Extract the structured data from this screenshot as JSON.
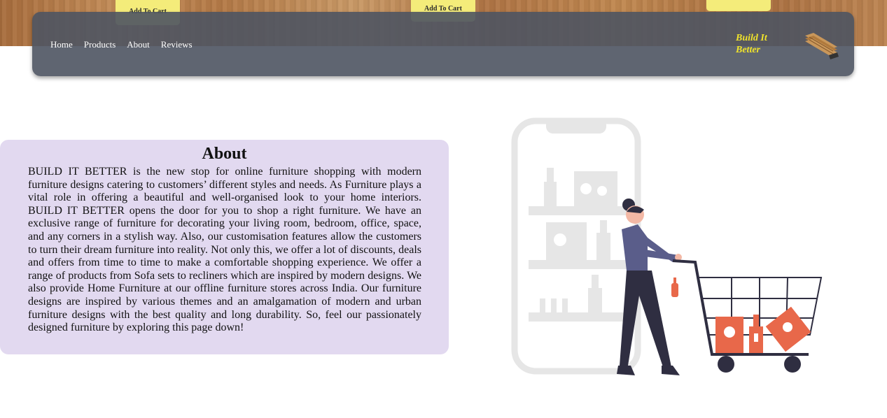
{
  "top_buttons": [
    {
      "label": "Add To Cart"
    },
    {
      "label": "Add To Cart"
    },
    {
      "label": ""
    }
  ],
  "nav": {
    "links": [
      "Home",
      "Products",
      "About",
      "Reviews"
    ],
    "brand_line1": "Build It",
    "brand_line2": "Better"
  },
  "about": {
    "title": "About",
    "body": "BUILD IT BETTER is the new stop for online furniture shopping with modern furniture designs catering to customers’ different styles and needs. As Furniture plays a vital role in offering a beautiful and well-organised look to your home interiors. BUILD IT BETTER opens the door for you to shop a right furniture. We have an exclusive range of furniture for decorating your living room, bedroom, office, space, and any corners in a stylish way. Also, our customisation features allow the customers to turn their dream furniture into reality. Not only this, we offer a lot of discounts, deals and offers from time to time to make a comfortable shopping experience. We offer a range of products from Sofa sets to recliners which are inspired by modern designs. We also provide Home Furniture at our offline furniture stores across India. Our furniture designs are inspired by various themes and an amalgamation of modern and urban furniture designs with the best quality and long durability. So, feel our passionately designed furniture by exploring this page down!"
  },
  "colors": {
    "navbar": "#4e5462",
    "brand": "#f0e32b",
    "button": "#f4ec7a",
    "about_bg": "#e2d9f0",
    "accent": "#e8684a"
  },
  "icons": [
    "bench-icon",
    "shopping-illustration"
  ]
}
